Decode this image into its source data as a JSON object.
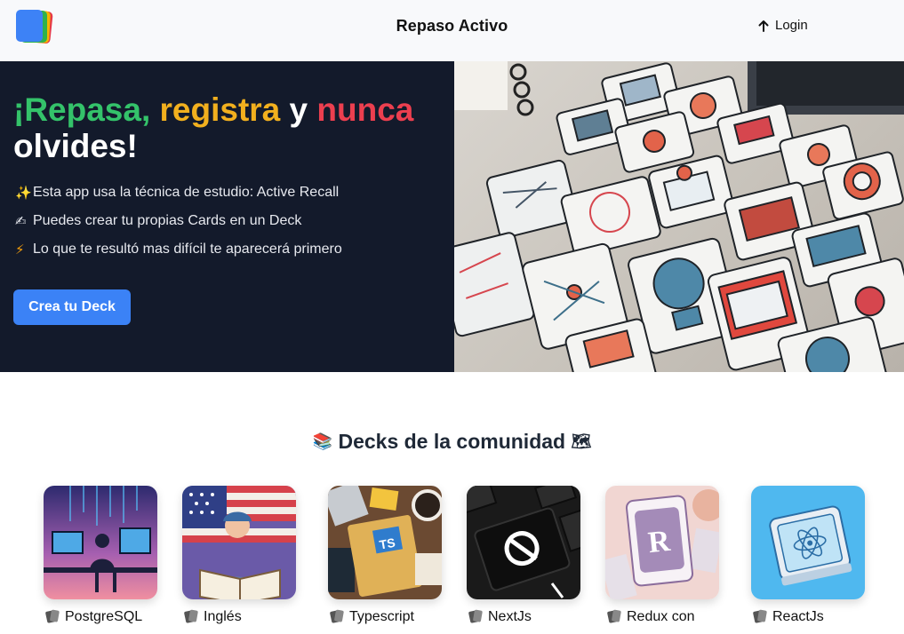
{
  "header": {
    "app_title": "Repaso Activo",
    "login_label": "Login",
    "login_icon": "arrow-up-icon"
  },
  "hero": {
    "headline": {
      "part1": "¡Repasa,",
      "part2": "registra",
      "part3": "y",
      "part4": "nunca",
      "part5": "olvides!"
    },
    "features": [
      {
        "icon": "sparkles-icon",
        "emoji": "✨",
        "text": "Esta app usa la técnica de estudio: Active Recall"
      },
      {
        "icon": "writing-hand-icon",
        "emoji": "✍",
        "text": "Puedes crear tu propias Cards en un Deck"
      },
      {
        "icon": "lightning-icon",
        "emoji": "⚡",
        "text": "Lo que te resultó mas difícil te aparecerá primero"
      }
    ],
    "cta_label": "Crea tu Deck",
    "image_alt": "flashcards-illustration"
  },
  "community": {
    "title": "Decks de la comunidad",
    "left_icon": "books-icon",
    "right_icon": "map-icon",
    "decks": [
      {
        "label": "PostgreSQL",
        "icon": "card-icon"
      },
      {
        "label": "Inglés",
        "icon": "card-icon"
      },
      {
        "label": "Typescript",
        "icon": "card-icon"
      },
      {
        "label": "NextJs",
        "icon": "card-icon"
      },
      {
        "label": "Redux con",
        "icon": "card-icon"
      },
      {
        "label": "ReactJs",
        "icon": "card-icon"
      }
    ]
  },
  "colors": {
    "hero_bg": "#131a2b",
    "green": "#34c36a",
    "yellow": "#f2b01e",
    "red": "#ec3f4f",
    "cta_blue": "#3b82f6"
  }
}
